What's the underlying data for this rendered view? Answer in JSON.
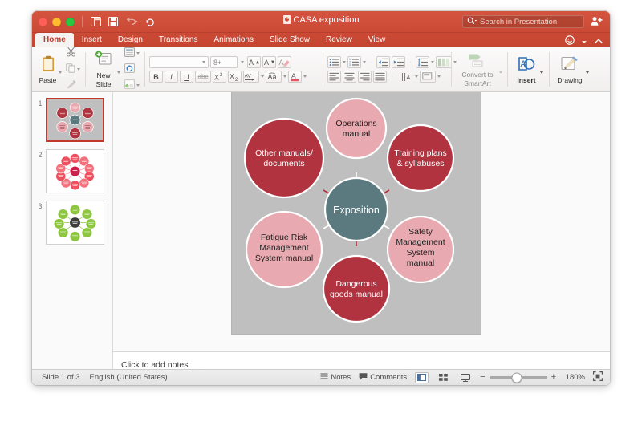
{
  "window": {
    "title": "CASA exposition",
    "traffic_lights": [
      "close",
      "minimize",
      "maximize"
    ],
    "quick_access": [
      "layout-icon",
      "save-icon",
      "undo-icon",
      "redo-icon"
    ]
  },
  "search": {
    "placeholder": "Search in Presentation",
    "value": ""
  },
  "tabs": [
    {
      "label": "Home",
      "active": true
    },
    {
      "label": "Insert",
      "active": false
    },
    {
      "label": "Design",
      "active": false
    },
    {
      "label": "Transitions",
      "active": false
    },
    {
      "label": "Animations",
      "active": false
    },
    {
      "label": "Slide Show",
      "active": false
    },
    {
      "label": "Review",
      "active": false
    },
    {
      "label": "View",
      "active": false
    }
  ],
  "ribbon": {
    "paste_label": "Paste",
    "cut_icon": "scissors-icon",
    "copy_icon": "copy-icon",
    "format_painter_icon": "format-painter-icon",
    "new_slide_label_line1": "New",
    "new_slide_label_line2": "Slide",
    "layout_icon": "slide-layout-icon",
    "reset_icon": "reset-slide-icon",
    "section_icon": "section-icon",
    "font_name": "",
    "font_size": "8+",
    "grow_font": "A",
    "shrink_font": "A",
    "clear_format_icon": "clear-formatting-icon",
    "bold": "B",
    "italic": "I",
    "underline": "U",
    "strikethrough": "abc",
    "superscript": "X",
    "subscript": "X",
    "char_spacing_icon": "character-spacing-icon",
    "change_case_icon": "change-case-icon",
    "font_color_icon": "font-color-icon",
    "bullets_icon": "bullets-icon",
    "numbering_icon": "numbering-icon",
    "decrease_indent_icon": "decrease-indent-icon",
    "increase_indent_icon": "increase-indent-icon",
    "line_spacing_icon": "line-spacing-icon",
    "columns_icon": "columns-icon",
    "align_left_icon": "align-left-icon",
    "align_center_icon": "align-center-icon",
    "align_right_icon": "align-right-icon",
    "justify_icon": "justify-icon",
    "text_direction_icon": "text-direction-icon",
    "align_text_icon": "align-text-icon",
    "convert_label_line1": "Convert to",
    "convert_label_line2": "SmartArt",
    "insert_label": "Insert",
    "drawing_label": "Drawing"
  },
  "slide_panel": {
    "slides": [
      {
        "number": "1",
        "selected": true,
        "theme": "red-radial"
      },
      {
        "number": "2",
        "selected": false,
        "theme": "pink-radial"
      },
      {
        "number": "3",
        "selected": false,
        "theme": "green-radial"
      }
    ]
  },
  "notes": {
    "placeholder": "Click to add notes"
  },
  "statusbar": {
    "slide_counter": "Slide 1 of 3",
    "language": "English (United States)",
    "notes_label": "Notes",
    "comments_label": "Comments",
    "zoom_value": "180%",
    "zoom_minus": "−",
    "zoom_plus": "+",
    "views": [
      "normal-view-icon",
      "slide-sorter-icon",
      "presenter-view-icon"
    ],
    "fit_icon": "fit-to-window-icon"
  },
  "colors": {
    "ribbon_red": "#cb4a36",
    "tab_active_text": "#c0392b",
    "slide_bg": "#bfbfbf",
    "center_node": "#5b7a80",
    "dark_red": "#b0333f",
    "light_pink": "#e8aab0",
    "node_stroke": "#ffffff"
  },
  "diagram": {
    "type": "radial-cycle",
    "center": {
      "label": "Exposition",
      "fill": "#5b7a80",
      "text_color": "#ffffff"
    },
    "nodes": [
      {
        "label": "Operations manual",
        "lines": [
          "Operations",
          "manual"
        ],
        "fill": "#e8aab0",
        "text_color": "#1f1f1f",
        "angle_deg": 270,
        "position": "top"
      },
      {
        "label": "Training plans & syllabuses",
        "lines": [
          "Training plans",
          "& syllabuses"
        ],
        "fill": "#b0333f",
        "text_color": "#ffffff",
        "angle_deg": 322,
        "position": "top-right"
      },
      {
        "label": "Safety Management System manual",
        "lines": [
          "Safety",
          "Management",
          "System",
          "manual"
        ],
        "fill": "#e8aab0",
        "text_color": "#1f1f1f",
        "angle_deg": 37,
        "position": "bottom-right"
      },
      {
        "label": "Dangerous goods manual",
        "lines": [
          "Dangerous",
          "goods manual"
        ],
        "fill": "#b0333f",
        "text_color": "#ffffff",
        "angle_deg": 90,
        "position": "bottom"
      },
      {
        "label": "Fatigue Risk Management System manual",
        "lines": [
          "Fatigue Risk",
          "Management",
          "System manual"
        ],
        "fill": "#e8aab0",
        "text_color": "#1f1f1f",
        "angle_deg": 143,
        "position": "bottom-left"
      },
      {
        "label": "Other manuals/ documents",
        "lines": [
          "Other manuals/",
          "documents"
        ],
        "fill": "#b0333f",
        "text_color": "#ffffff",
        "angle_deg": 208,
        "position": "top-left"
      }
    ]
  }
}
